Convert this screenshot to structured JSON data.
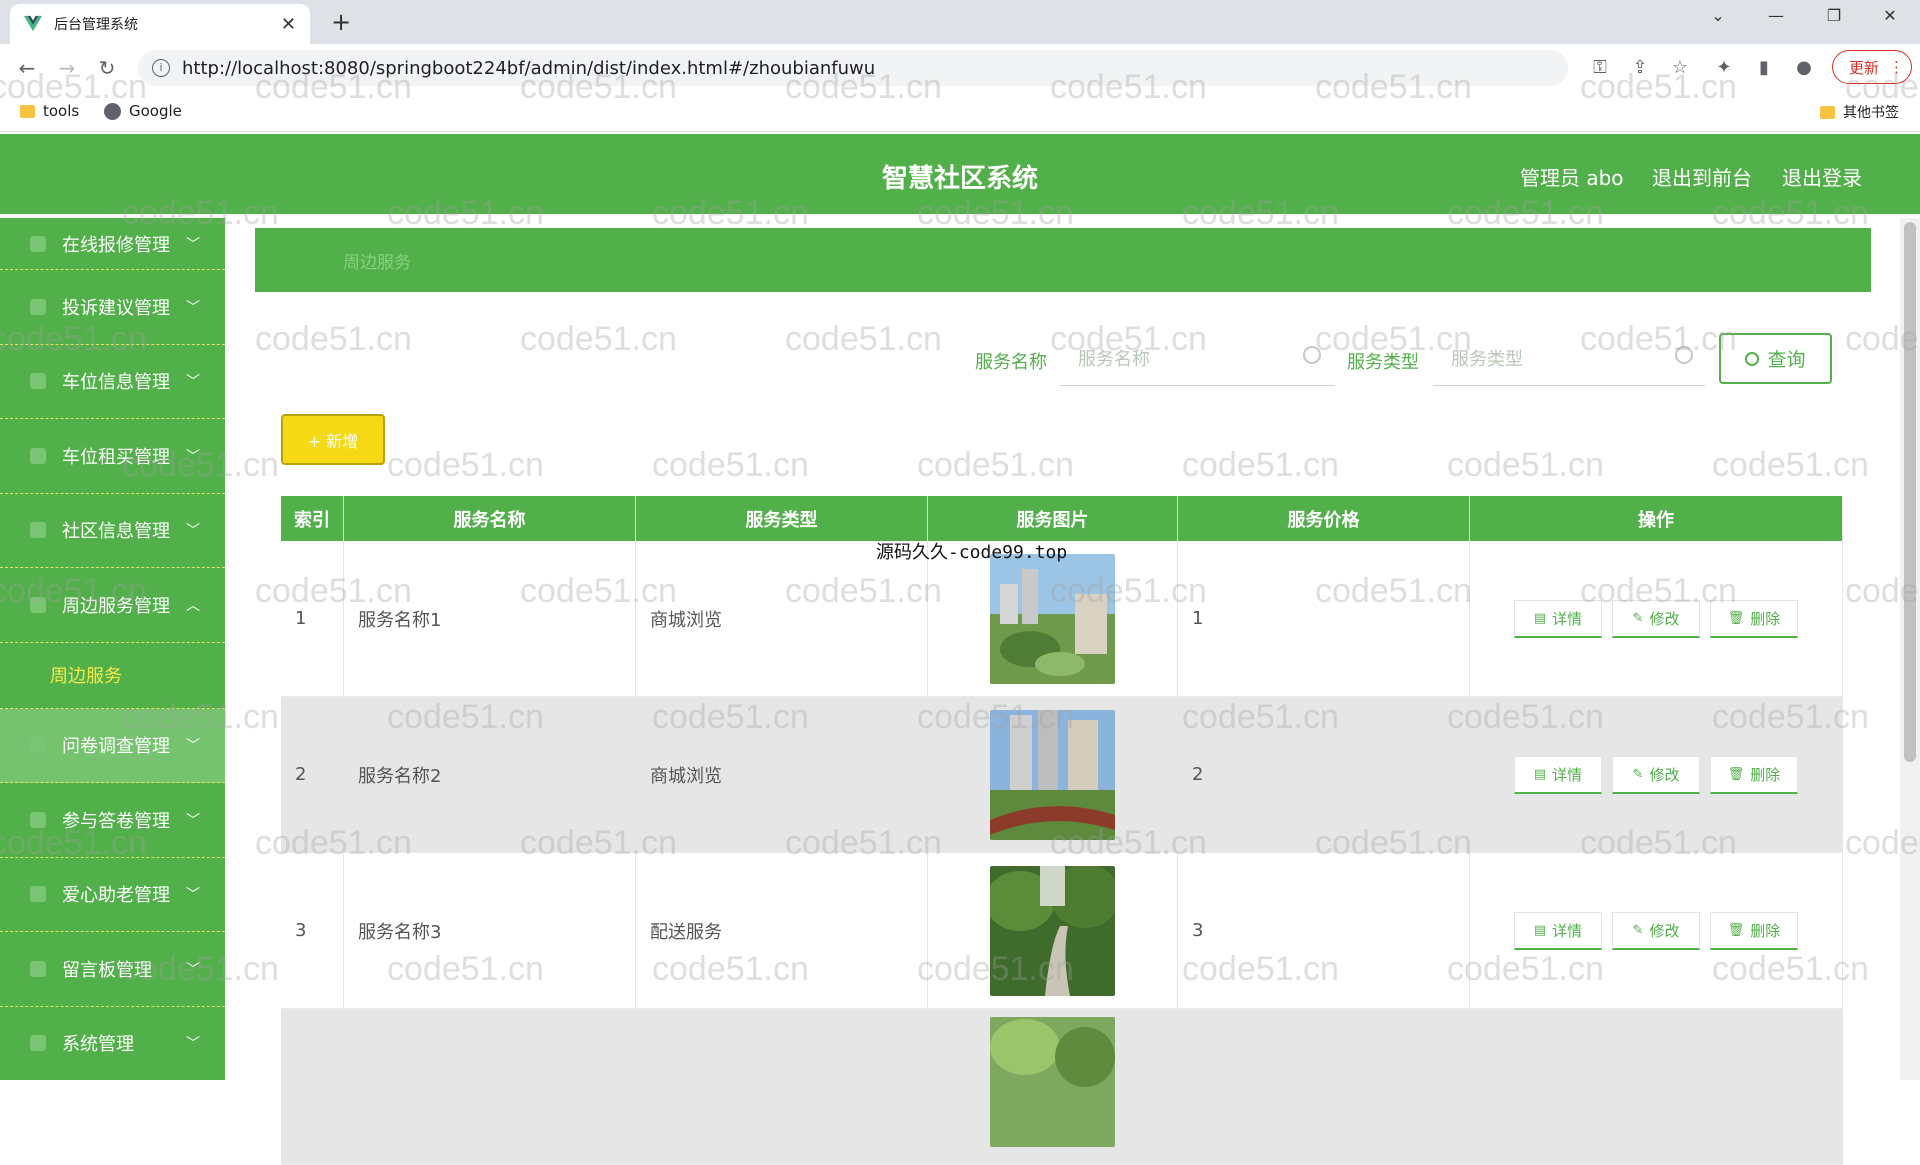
{
  "browser": {
    "tab_title": "后台管理系统",
    "url": "http://localhost:8080/springboot224bf/admin/dist/index.html#/zhoubianfuwu",
    "update_label": "更新",
    "bookmarks": [
      "tools",
      "Google"
    ],
    "other_bookmarks": "其他书签"
  },
  "header": {
    "title": "智慧社区系统",
    "user": "管理员 abo",
    "to_front": "退出到前台",
    "logout": "退出登录"
  },
  "sidebar": {
    "items": [
      {
        "label": "在线报修管理"
      },
      {
        "label": "投诉建议管理"
      },
      {
        "label": "车位信息管理"
      },
      {
        "label": "车位租买管理"
      },
      {
        "label": "社区信息管理"
      },
      {
        "label": "周边服务管理",
        "expanded": true
      },
      {
        "label": "问卷调查管理"
      },
      {
        "label": "参与答卷管理"
      },
      {
        "label": "爱心助老管理"
      },
      {
        "label": "留言板管理"
      },
      {
        "label": "系统管理"
      }
    ],
    "active_sub": "周边服务"
  },
  "breadcrumb": "周边服务",
  "search": {
    "name_label": "服务名称",
    "name_placeholder": "服务名称",
    "type_label": "服务类型",
    "type_placeholder": "服务类型",
    "query_label": "查询"
  },
  "add_label": "+ 新增",
  "table": {
    "headers": [
      "索引",
      "服务名称",
      "服务类型",
      "服务图片",
      "服务价格",
      "操作"
    ],
    "rows": [
      {
        "index": "1",
        "name": "服务名称1",
        "type": "商城浏览",
        "price": "1"
      },
      {
        "index": "2",
        "name": "服务名称2",
        "type": "商城浏览",
        "price": "2"
      },
      {
        "index": "3",
        "name": "服务名称3",
        "type": "配送服务",
        "price": "3"
      },
      {
        "index": "",
        "name": "",
        "type": "",
        "price": ""
      }
    ],
    "ops": {
      "detail": "详情",
      "edit": "修改",
      "delete": "删除"
    }
  },
  "overlay_text": "源码久久-code99.top",
  "watermark": "code51.cn",
  "colors": {
    "primary": "#52b04a",
    "accent": "#f5d915"
  }
}
